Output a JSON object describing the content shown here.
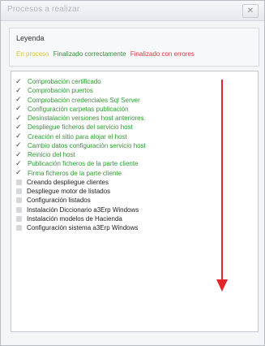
{
  "window": {
    "title": "Procesos a realizar",
    "close_label": "✕"
  },
  "legend": {
    "title": "Leyenda",
    "in_process": "En proceso",
    "ok": "Finalizado correctamente",
    "error": "Finalizado con errores"
  },
  "colors": {
    "in_process": "#d6c23b",
    "ok": "#2e8f33",
    "error": "#e0353b",
    "arrow": "#e4262b"
  },
  "tasks": [
    {
      "label": "Comprobación certificado",
      "checked": true
    },
    {
      "label": "Comprobación puertos",
      "checked": true
    },
    {
      "label": "Comprobación credenciales Sql Server",
      "checked": true
    },
    {
      "label": "Configuración carpetas publicación",
      "checked": true
    },
    {
      "label": "Desinstalación versiones host anteriores.",
      "checked": true
    },
    {
      "label": "Despliegue ficheros del servicio host",
      "checked": true
    },
    {
      "label": "Creación el sitio para alojar el host",
      "checked": true
    },
    {
      "label": "Cambio datos configuración servicio host",
      "checked": true
    },
    {
      "label": "Reinicio del host",
      "checked": true
    },
    {
      "label": "Publicación ficheros de la parte cliente",
      "checked": true
    },
    {
      "label": "Firma ficheros de la parte cliente",
      "checked": true
    },
    {
      "label": "Creando despliegue clientes",
      "checked": false
    },
    {
      "label": "Despliegue motor de listados",
      "checked": false
    },
    {
      "label": "Configuración listados",
      "checked": false
    },
    {
      "label": "Instalación Diccionario a3Erp Windows",
      "checked": false
    },
    {
      "label": "Instalación modelos de Hacienda",
      "checked": false
    },
    {
      "label": "Configuración sistema a3Erp Windows",
      "checked": false
    }
  ]
}
